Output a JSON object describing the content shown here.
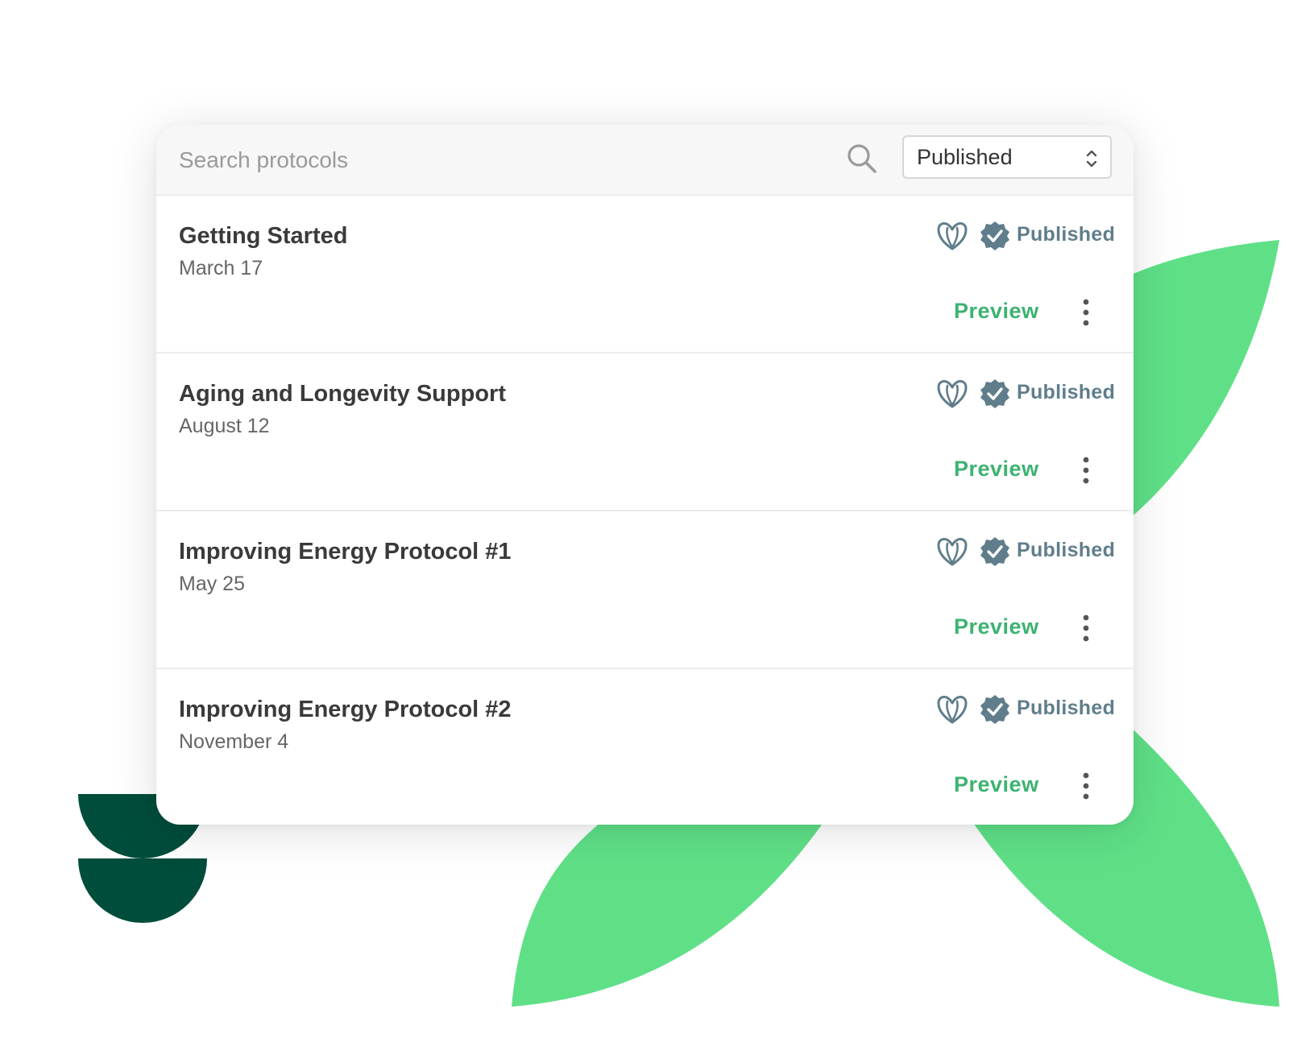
{
  "search": {
    "placeholder": "Search protocols"
  },
  "filter": {
    "selected": "Published"
  },
  "colors": {
    "accent_green": "#3cb371",
    "decor_green": "#5fe087",
    "decor_dark": "#004d3b",
    "status_gray": "#607d8b"
  },
  "protocols": [
    {
      "title": "Getting Started",
      "date": "March 17",
      "status": "Published",
      "preview_label": "Preview"
    },
    {
      "title": "Aging and Longevity Support",
      "date": "August 12",
      "status": "Published",
      "preview_label": "Preview"
    },
    {
      "title": "Improving Energy Protocol #1",
      "date": "May 25",
      "status": "Published",
      "preview_label": "Preview"
    },
    {
      "title": "Improving Energy Protocol #2",
      "date": "November 4",
      "status": "Published",
      "preview_label": "Preview"
    }
  ],
  "icons": {
    "search": "search-icon",
    "select_arrows": "chevron-updown-icon",
    "leaf": "leaf-heart-icon",
    "verified": "verified-badge-icon",
    "more": "more-vertical-icon"
  }
}
